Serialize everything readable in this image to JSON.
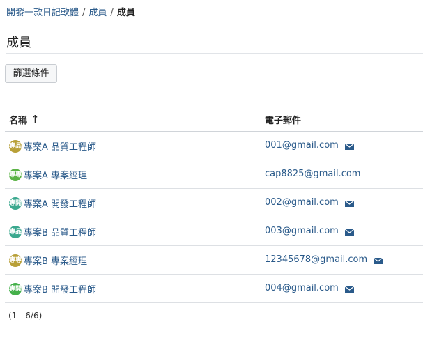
{
  "breadcrumb": {
    "project": "開發一款日記軟體",
    "section": "成員",
    "current": "成員",
    "separator": "/"
  },
  "page_title": "成員",
  "filter_button": "篩選條件",
  "table": {
    "columns": {
      "name": "名稱",
      "email": "電子郵件"
    },
    "sort_indicator": "↑",
    "rows": [
      {
        "avatar_text": "專品",
        "avatar_color": "#b8a038",
        "name": "專案A 品質工程師",
        "email": "001@gmail.com",
        "has_mail_icon": true
      },
      {
        "avatar_text": "專專",
        "avatar_color": "#5bb346",
        "name": "專案A 專案經理",
        "email": "cap8825@gmail.com",
        "has_mail_icon": false
      },
      {
        "avatar_text": "專開",
        "avatar_color": "#3aa88e",
        "name": "專案A 開發工程師",
        "email": "002@gmail.com",
        "has_mail_icon": true
      },
      {
        "avatar_text": "專品",
        "avatar_color": "#3aa88e",
        "name": "專案B 品質工程師",
        "email": "003@gmail.com",
        "has_mail_icon": true
      },
      {
        "avatar_text": "專專",
        "avatar_color": "#b8a038",
        "name": "專案B 專案經理",
        "email": "12345678@gmail.com",
        "has_mail_icon": true
      },
      {
        "avatar_text": "專開",
        "avatar_color": "#44b04a",
        "name": "專案B 開發工程師",
        "email": "004@gmail.com",
        "has_mail_icon": true
      }
    ]
  },
  "pagination": "(1 - 6/6)",
  "colors": {
    "link": "#2a5a8a",
    "mail_icon": "#2a5a8a"
  },
  "icons": {
    "mail": "envelope-icon"
  }
}
